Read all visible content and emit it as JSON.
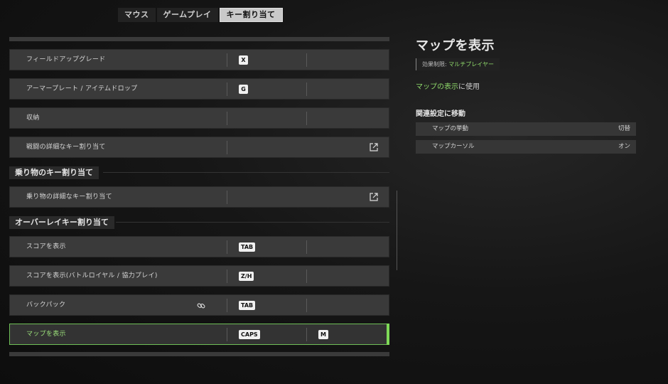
{
  "tabs": [
    "マウス",
    "ゲームプレイ",
    "キー割り当て"
  ],
  "rows": {
    "field_upgrade": {
      "label": "フィールドアップグレード",
      "key1": "X"
    },
    "armor_plate": {
      "label": "アーマープレート / アイテムドロップ",
      "key1": "G"
    },
    "stow": {
      "label": "収納"
    },
    "combat_detailed": {
      "label": "戦闘の詳細なキー割り当て"
    },
    "vehicle_detailed": {
      "label": "乗り物の詳細なキー割り当て"
    },
    "show_score": {
      "label": "スコアを表示",
      "key1": "TAB"
    },
    "show_score_br": {
      "label": "スコアを表示(バトルロイヤル / 協力プレイ)",
      "key1": "Z/H"
    },
    "backpack": {
      "label": "バックパック",
      "key1": "TAB"
    },
    "show_map": {
      "label": "マップを表示",
      "key1": "CAPS",
      "key2": "M"
    }
  },
  "sections": {
    "vehicle": "乗り物のキー割り当て",
    "overlay": "オーバーレイキー割り当て"
  },
  "detail": {
    "title": "マップを表示",
    "effect_label": "効果制限: ",
    "effect_value": "マルチプレイヤー",
    "use_highlight": "マップの表示",
    "use_suffix": "に使用",
    "related_title": "関連設定に移動",
    "related": [
      {
        "name": "マップの挙動",
        "value": "切替"
      },
      {
        "name": "マップカーソル",
        "value": "オン"
      }
    ]
  },
  "colors": {
    "accent": "#7ed957"
  }
}
